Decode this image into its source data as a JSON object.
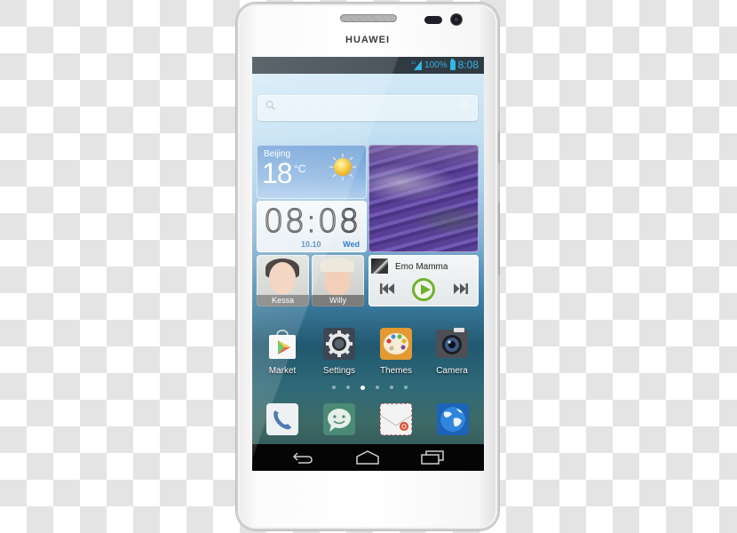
{
  "device": {
    "brand": "HUAWEI"
  },
  "status_bar": {
    "network": "3G",
    "battery": "100%",
    "time": "8:08",
    "accent_color": "#33b5e5"
  },
  "search": {
    "placeholder": ""
  },
  "weather_widget": {
    "city": "Beijing",
    "temperature": "18",
    "unit": "°C",
    "condition_icon": "sun-icon"
  },
  "clock_widget": {
    "time": "08:08",
    "date": "10.10",
    "day": "Wed"
  },
  "contacts": [
    {
      "name": "Kessa"
    },
    {
      "name": "Willy"
    }
  ],
  "music_widget": {
    "song_title": "Emo Mamma",
    "accent_color": "#6fb22c"
  },
  "apps": [
    {
      "label": "Market",
      "icon": "market-icon"
    },
    {
      "label": "Settings",
      "icon": "settings-gear-icon"
    },
    {
      "label": "Themes",
      "icon": "themes-palette-icon"
    },
    {
      "label": "Camera",
      "icon": "camera-icon"
    }
  ],
  "home_pages": {
    "count": 6,
    "active_index": 2
  },
  "dock": [
    {
      "icon": "phone-icon"
    },
    {
      "icon": "messaging-icon"
    },
    {
      "icon": "email-icon"
    },
    {
      "icon": "browser-globe-icon"
    }
  ],
  "navigation": {
    "back": "back-icon",
    "home": "home-icon",
    "recent": "recent-apps-icon"
  }
}
